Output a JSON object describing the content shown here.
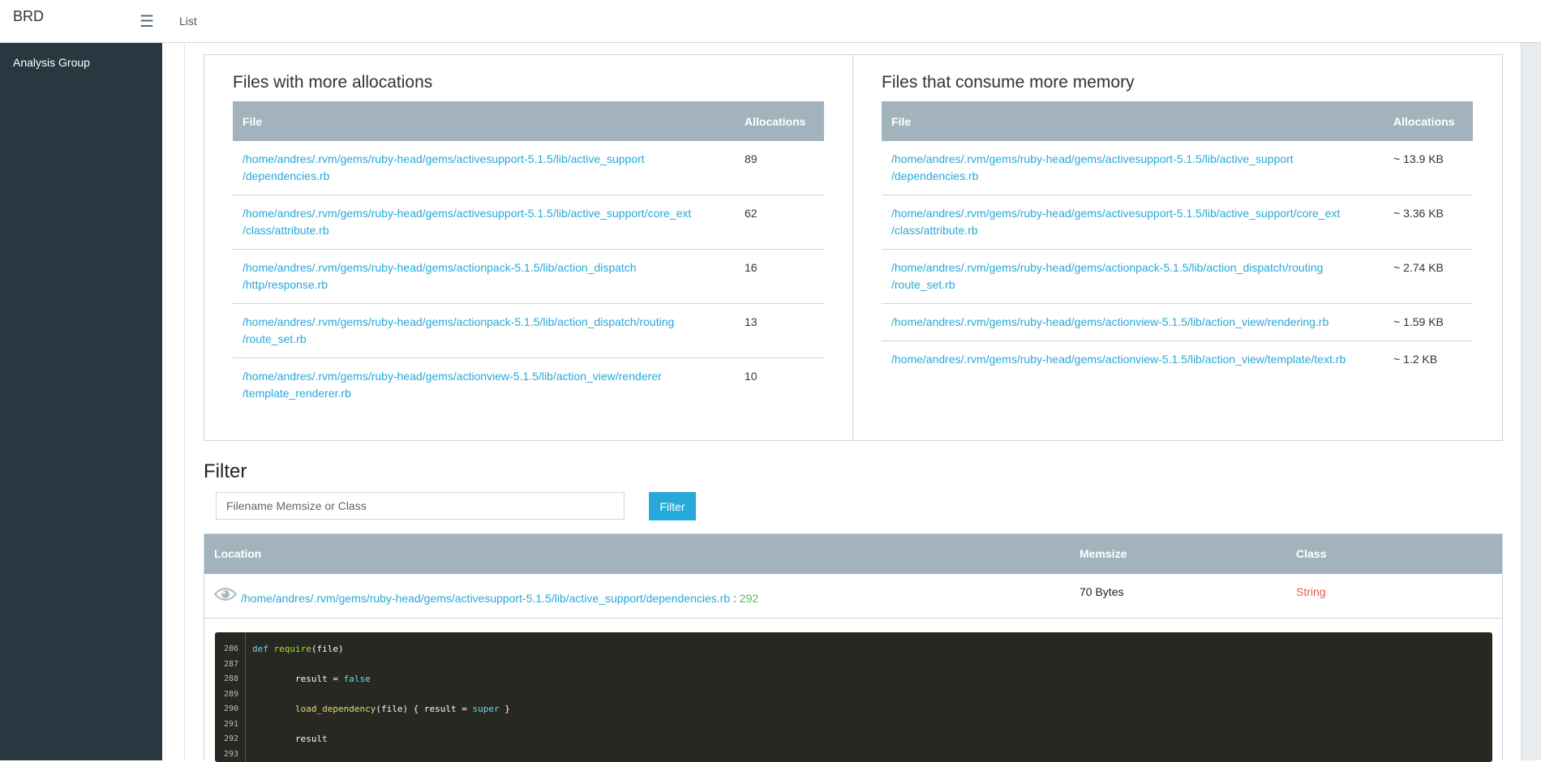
{
  "header": {
    "brand": "BRD",
    "nav_list": "List"
  },
  "sidebar": {
    "items": [
      {
        "label": "Analysis Group"
      }
    ]
  },
  "allocations_panel": {
    "title": "Files with more allocations",
    "columns": [
      "File",
      "Allocations"
    ],
    "rows": [
      {
        "file_l1": "/home/andres/.rvm/gems/ruby-head/gems/activesupport-5.1.5/lib/active_support",
        "file_l2": "/dependencies.rb",
        "count": "89"
      },
      {
        "file_l1": "/home/andres/.rvm/gems/ruby-head/gems/activesupport-5.1.5/lib/active_support/core_ext",
        "file_l2": "/class/attribute.rb",
        "count": "62"
      },
      {
        "file_l1": "/home/andres/.rvm/gems/ruby-head/gems/actionpack-5.1.5/lib/action_dispatch",
        "file_l2": "/http/response.rb",
        "count": "16"
      },
      {
        "file_l1": "/home/andres/.rvm/gems/ruby-head/gems/actionpack-5.1.5/lib/action_dispatch/routing",
        "file_l2": "/route_set.rb",
        "count": "13"
      },
      {
        "file_l1": "/home/andres/.rvm/gems/ruby-head/gems/actionview-5.1.5/lib/action_view/renderer",
        "file_l2": "/template_renderer.rb",
        "count": "10"
      }
    ]
  },
  "memory_panel": {
    "title": "Files that consume more memory",
    "columns": [
      "File",
      "Allocations"
    ],
    "rows": [
      {
        "file_l1": "/home/andres/.rvm/gems/ruby-head/gems/activesupport-5.1.5/lib/active_support",
        "file_l2": "/dependencies.rb",
        "size": "~ 13.9 KB"
      },
      {
        "file_l1": "/home/andres/.rvm/gems/ruby-head/gems/activesupport-5.1.5/lib/active_support/core_ext",
        "file_l2": "/class/attribute.rb",
        "size": "~ 3.36 KB"
      },
      {
        "file_l1": "/home/andres/.rvm/gems/ruby-head/gems/actionpack-5.1.5/lib/action_dispatch/routing",
        "file_l2": "/route_set.rb",
        "size": "~ 2.74 KB"
      },
      {
        "file_l1": "/home/andres/.rvm/gems/ruby-head/gems/actionview-5.1.5/lib/action_view/rendering.rb",
        "file_l2": "",
        "size": "~ 1.59 KB"
      },
      {
        "file_l1": "/home/andres/.rvm/gems/ruby-head/gems/actionview-5.1.5/lib/action_view/template/text.rb",
        "file_l2": "",
        "size": "~ 1.2 KB"
      }
    ]
  },
  "filter": {
    "title": "Filter",
    "input_value": "",
    "placeholder": "Filename Memsize or Class",
    "button_label": "Filter"
  },
  "results": {
    "columns": {
      "location": "Location",
      "memsize": "Memsize",
      "class": "Class"
    },
    "row": {
      "path": "/home/andres/.rvm/gems/ruby-head/gems/activesupport-5.1.5/lib/active_support/dependencies.rb",
      "separator": " : ",
      "line": "292",
      "memsize": "70 Bytes",
      "class": "String"
    }
  },
  "code": {
    "lines": [
      {
        "n": "286",
        "text": "def require(file)"
      },
      {
        "n": "287",
        "text": ""
      },
      {
        "n": "288",
        "text": "        result = false"
      },
      {
        "n": "289",
        "text": ""
      },
      {
        "n": "290",
        "text": "        load_dependency(file) { result = super }"
      },
      {
        "n": "291",
        "text": ""
      },
      {
        "n": "292",
        "text": "        result"
      },
      {
        "n": "293",
        "text": ""
      }
    ]
  },
  "colors": {
    "sidebar_bg": "#283740",
    "header_row_bg": "#a3b3bd",
    "link": "#27a9d9",
    "button_bg": "#27a9d9",
    "line_number": "#5cb85c",
    "class_text": "#e8574e",
    "code_bg": "#272822"
  },
  "icons": {
    "menu": "hamburger-icon",
    "view": "eye-icon"
  }
}
